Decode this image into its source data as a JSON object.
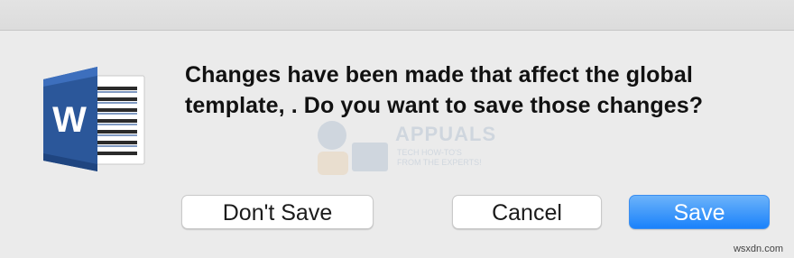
{
  "dialog": {
    "icon": "microsoft-word-icon",
    "icon_letter": "W",
    "message": "Changes have been made that affect the global template, . Do you want to save those changes?"
  },
  "buttons": {
    "dont_save_label": "Don't Save",
    "cancel_label": "Cancel",
    "save_label": "Save"
  },
  "watermark": {
    "name": "APPUALS",
    "tagline": "TECH HOW-TO'S FROM THE EXPERTS!"
  },
  "site_tag": "wsxdn.com",
  "colors": {
    "background": "#ebebeb",
    "primary_button": "#1a82fb",
    "word_blue": "#2b579a"
  }
}
